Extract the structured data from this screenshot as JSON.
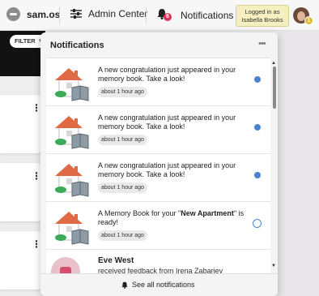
{
  "topbar": {
    "brand": "sam.os",
    "admin_label": "Admin Center",
    "notifications_label": "Notifications",
    "notification_count": "6",
    "logged_in_line1": "Logged in as",
    "logged_in_user": "Isabella Brooks",
    "avatar_badge": "1"
  },
  "background": {
    "filter_label": "FILTER"
  },
  "panel": {
    "title": "Notifications",
    "more_icon": "more-dots-icon",
    "items": [
      {
        "text": "A new congratulation just appeared in your memory book. Take a look!",
        "time": "about 1 hour ago",
        "unread": true
      },
      {
        "text": "A new congratulation just appeared in your memory book. Take a look!",
        "time": "about 1 hour ago",
        "unread": true
      },
      {
        "text": "A new congratulation just appeared in your memory book. Take a look!",
        "time": "about 1 hour ago",
        "unread": true
      },
      {
        "text_pre": "A Memory Book for your \"",
        "text_bold": "New Apartment",
        "text_post": "\" is ready!",
        "time": "about 1 hour ago",
        "unread": false
      }
    ],
    "feedback": {
      "name": "Eve West",
      "text": "received feedback from Irena Zabariev"
    },
    "footer_label": "See all notifications"
  },
  "colors": {
    "unread_dot": "#4a84d1",
    "badge": "#d9345a",
    "logged_bg": "#f6efbf"
  }
}
